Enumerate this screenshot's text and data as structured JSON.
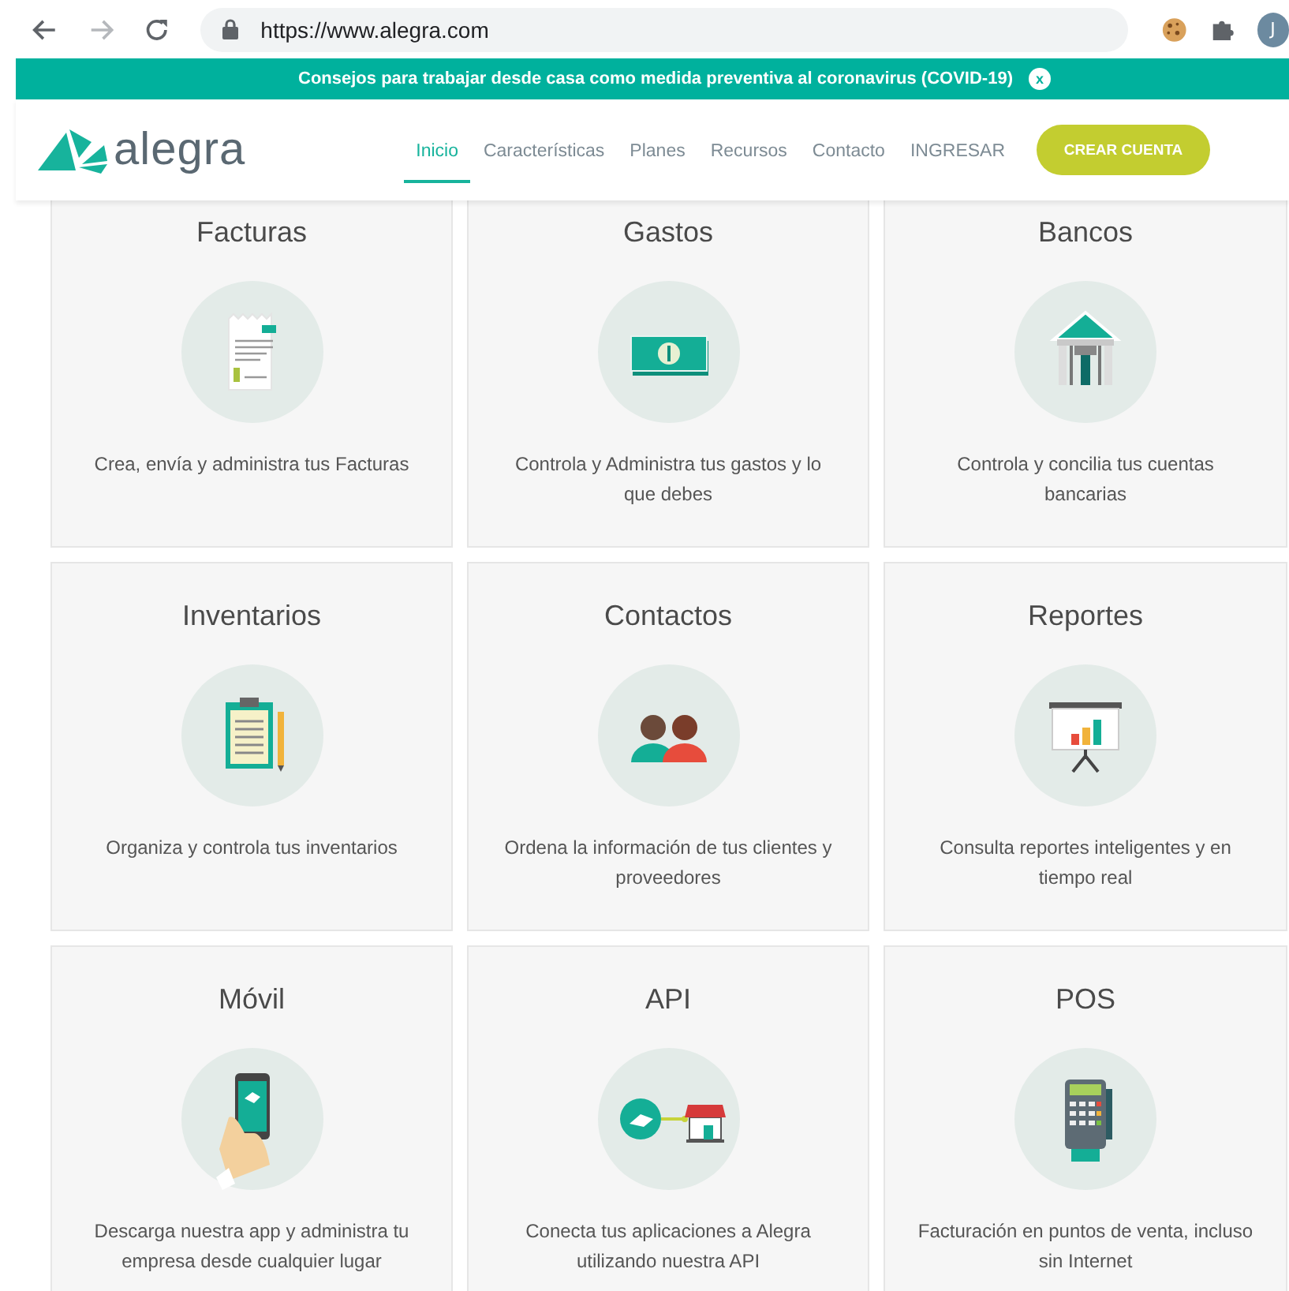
{
  "browser": {
    "url": "https://www.alegra.com",
    "forward_disabled": true,
    "profile_initial": "J"
  },
  "banner": {
    "text": "Consejos para trabajar desde casa como medida preventiva al coronavirus (COVID-19)",
    "close": "x"
  },
  "header": {
    "logo": "alegra",
    "nav": [
      {
        "label": "Inicio",
        "selected": true
      },
      {
        "label": "Características",
        "selected": false
      },
      {
        "label": "Planes",
        "selected": false
      },
      {
        "label": "Recursos",
        "selected": false
      },
      {
        "label": "Contacto",
        "selected": false
      },
      {
        "label": "INGRESAR",
        "selected": false
      }
    ],
    "cta": "CREAR CUENTA"
  },
  "cards": [
    {
      "title": "Facturas",
      "description": "Crea, envía y administra tus Facturas"
    },
    {
      "title": "Gastos",
      "description": "Controla y Administra tus gastos y lo que debes"
    },
    {
      "title": "Bancos",
      "description": "Controla y concilia tus cuentas bancarias"
    },
    {
      "title": "Inventarios",
      "description": "Organiza y controla tus inventarios"
    },
    {
      "title": "Contactos",
      "description": "Ordena la información de tus clientes y proveedores"
    },
    {
      "title": "Reportes",
      "description": "Consulta reportes inteligentes y en tiempo real"
    },
    {
      "title": "Móvil",
      "description": "Descarga nuestra app y administra tu empresa desde cualquier lugar"
    },
    {
      "title": "API",
      "description": "Conecta tus aplicaciones a Alegra utilizando nuestra API"
    },
    {
      "title": "POS",
      "description": "Facturación en puntos de venta, incluso sin Internet"
    }
  ]
}
